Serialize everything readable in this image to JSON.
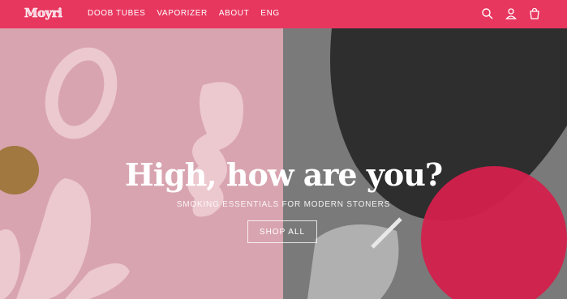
{
  "header": {
    "logo": "Moyri",
    "nav": [
      {
        "label": "DOOB TUBES"
      },
      {
        "label": "VAPORIZER"
      },
      {
        "label": "ABOUT"
      },
      {
        "label": "ENG"
      }
    ],
    "icons": [
      "search-icon",
      "account-icon",
      "cart-icon"
    ]
  },
  "hero": {
    "title": "High, how are you?",
    "subtitle": "SMOKING ESSENTIALS FOR MODERN STONERS",
    "cta": "SHOP ALL"
  },
  "colors": {
    "header_bg": "#e8375f",
    "hero_left_bg": "#d8a4b0",
    "blob_light": "#ecc8cf",
    "blob_brown": "#a07840",
    "circle_red": "#d4204c"
  }
}
